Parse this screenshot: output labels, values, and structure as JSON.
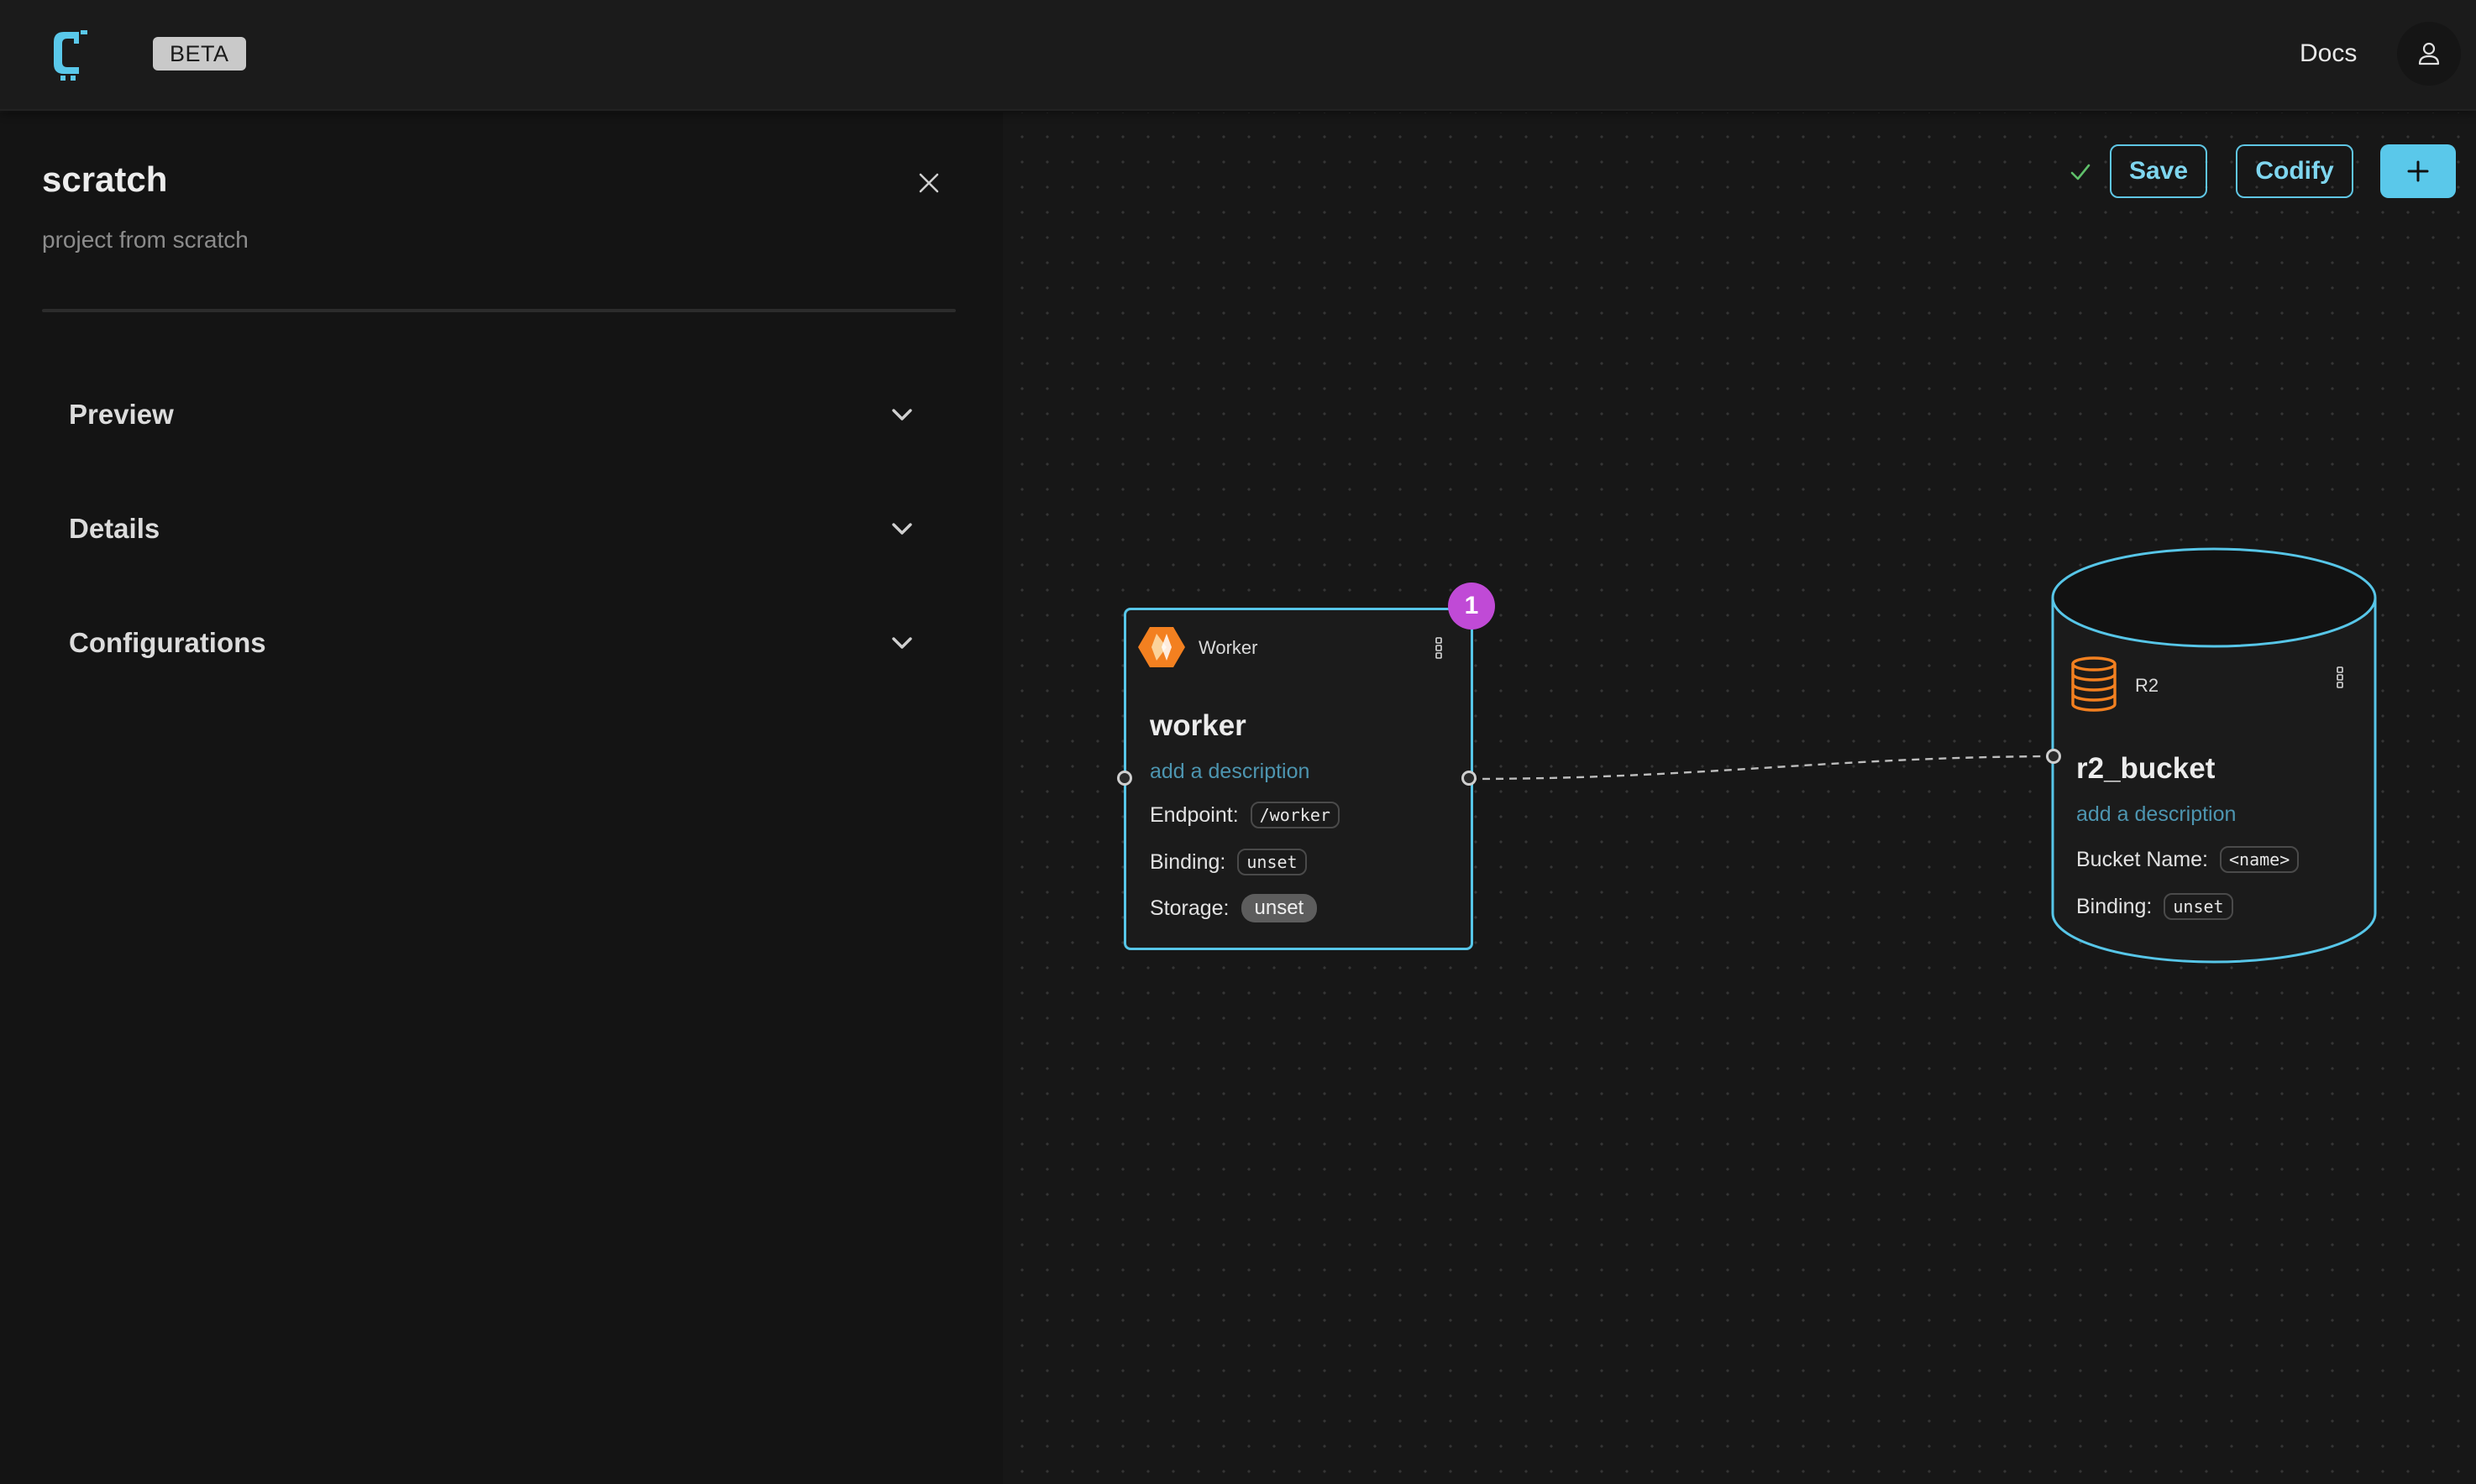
{
  "header": {
    "badge": "BETA",
    "docs_link": "Docs"
  },
  "project": {
    "title": "scratch",
    "subtitle": "project from scratch"
  },
  "sidebar": {
    "sections": [
      {
        "label": "Preview"
      },
      {
        "label": "Details"
      },
      {
        "label": "Configurations"
      }
    ]
  },
  "toolbar": {
    "save_label": "Save",
    "codify_label": "Codify",
    "add_label": "+"
  },
  "nodes": {
    "worker": {
      "type": "Worker",
      "name": "worker",
      "description_placeholder": "add a description",
      "endpoint_label": "Endpoint:",
      "endpoint_value": "/worker",
      "binding_label": "Binding:",
      "binding_value": "unset",
      "storage_label": "Storage:",
      "storage_value": "unset",
      "badge_count": "1"
    },
    "r2": {
      "type": "R2",
      "name": "r2_bucket",
      "description_placeholder": "add a description",
      "bucket_label": "Bucket Name:",
      "bucket_value": "<name>",
      "binding_label": "Binding:",
      "binding_value": "unset"
    }
  },
  "colors": {
    "accent": "#5ac8ea",
    "badge": "#c04ad6",
    "worker_icon": "#f38020",
    "r2_icon": "#f38020",
    "description_link": "#4d95b0"
  },
  "icons": {
    "logo": "c-logo-icon",
    "user": "user-icon",
    "close": "close-icon",
    "chevron": "chevron-down-icon",
    "check": "check-icon",
    "worker": "worker-icon",
    "r2": "database-icon",
    "menu": "kebab-menu-icon"
  }
}
